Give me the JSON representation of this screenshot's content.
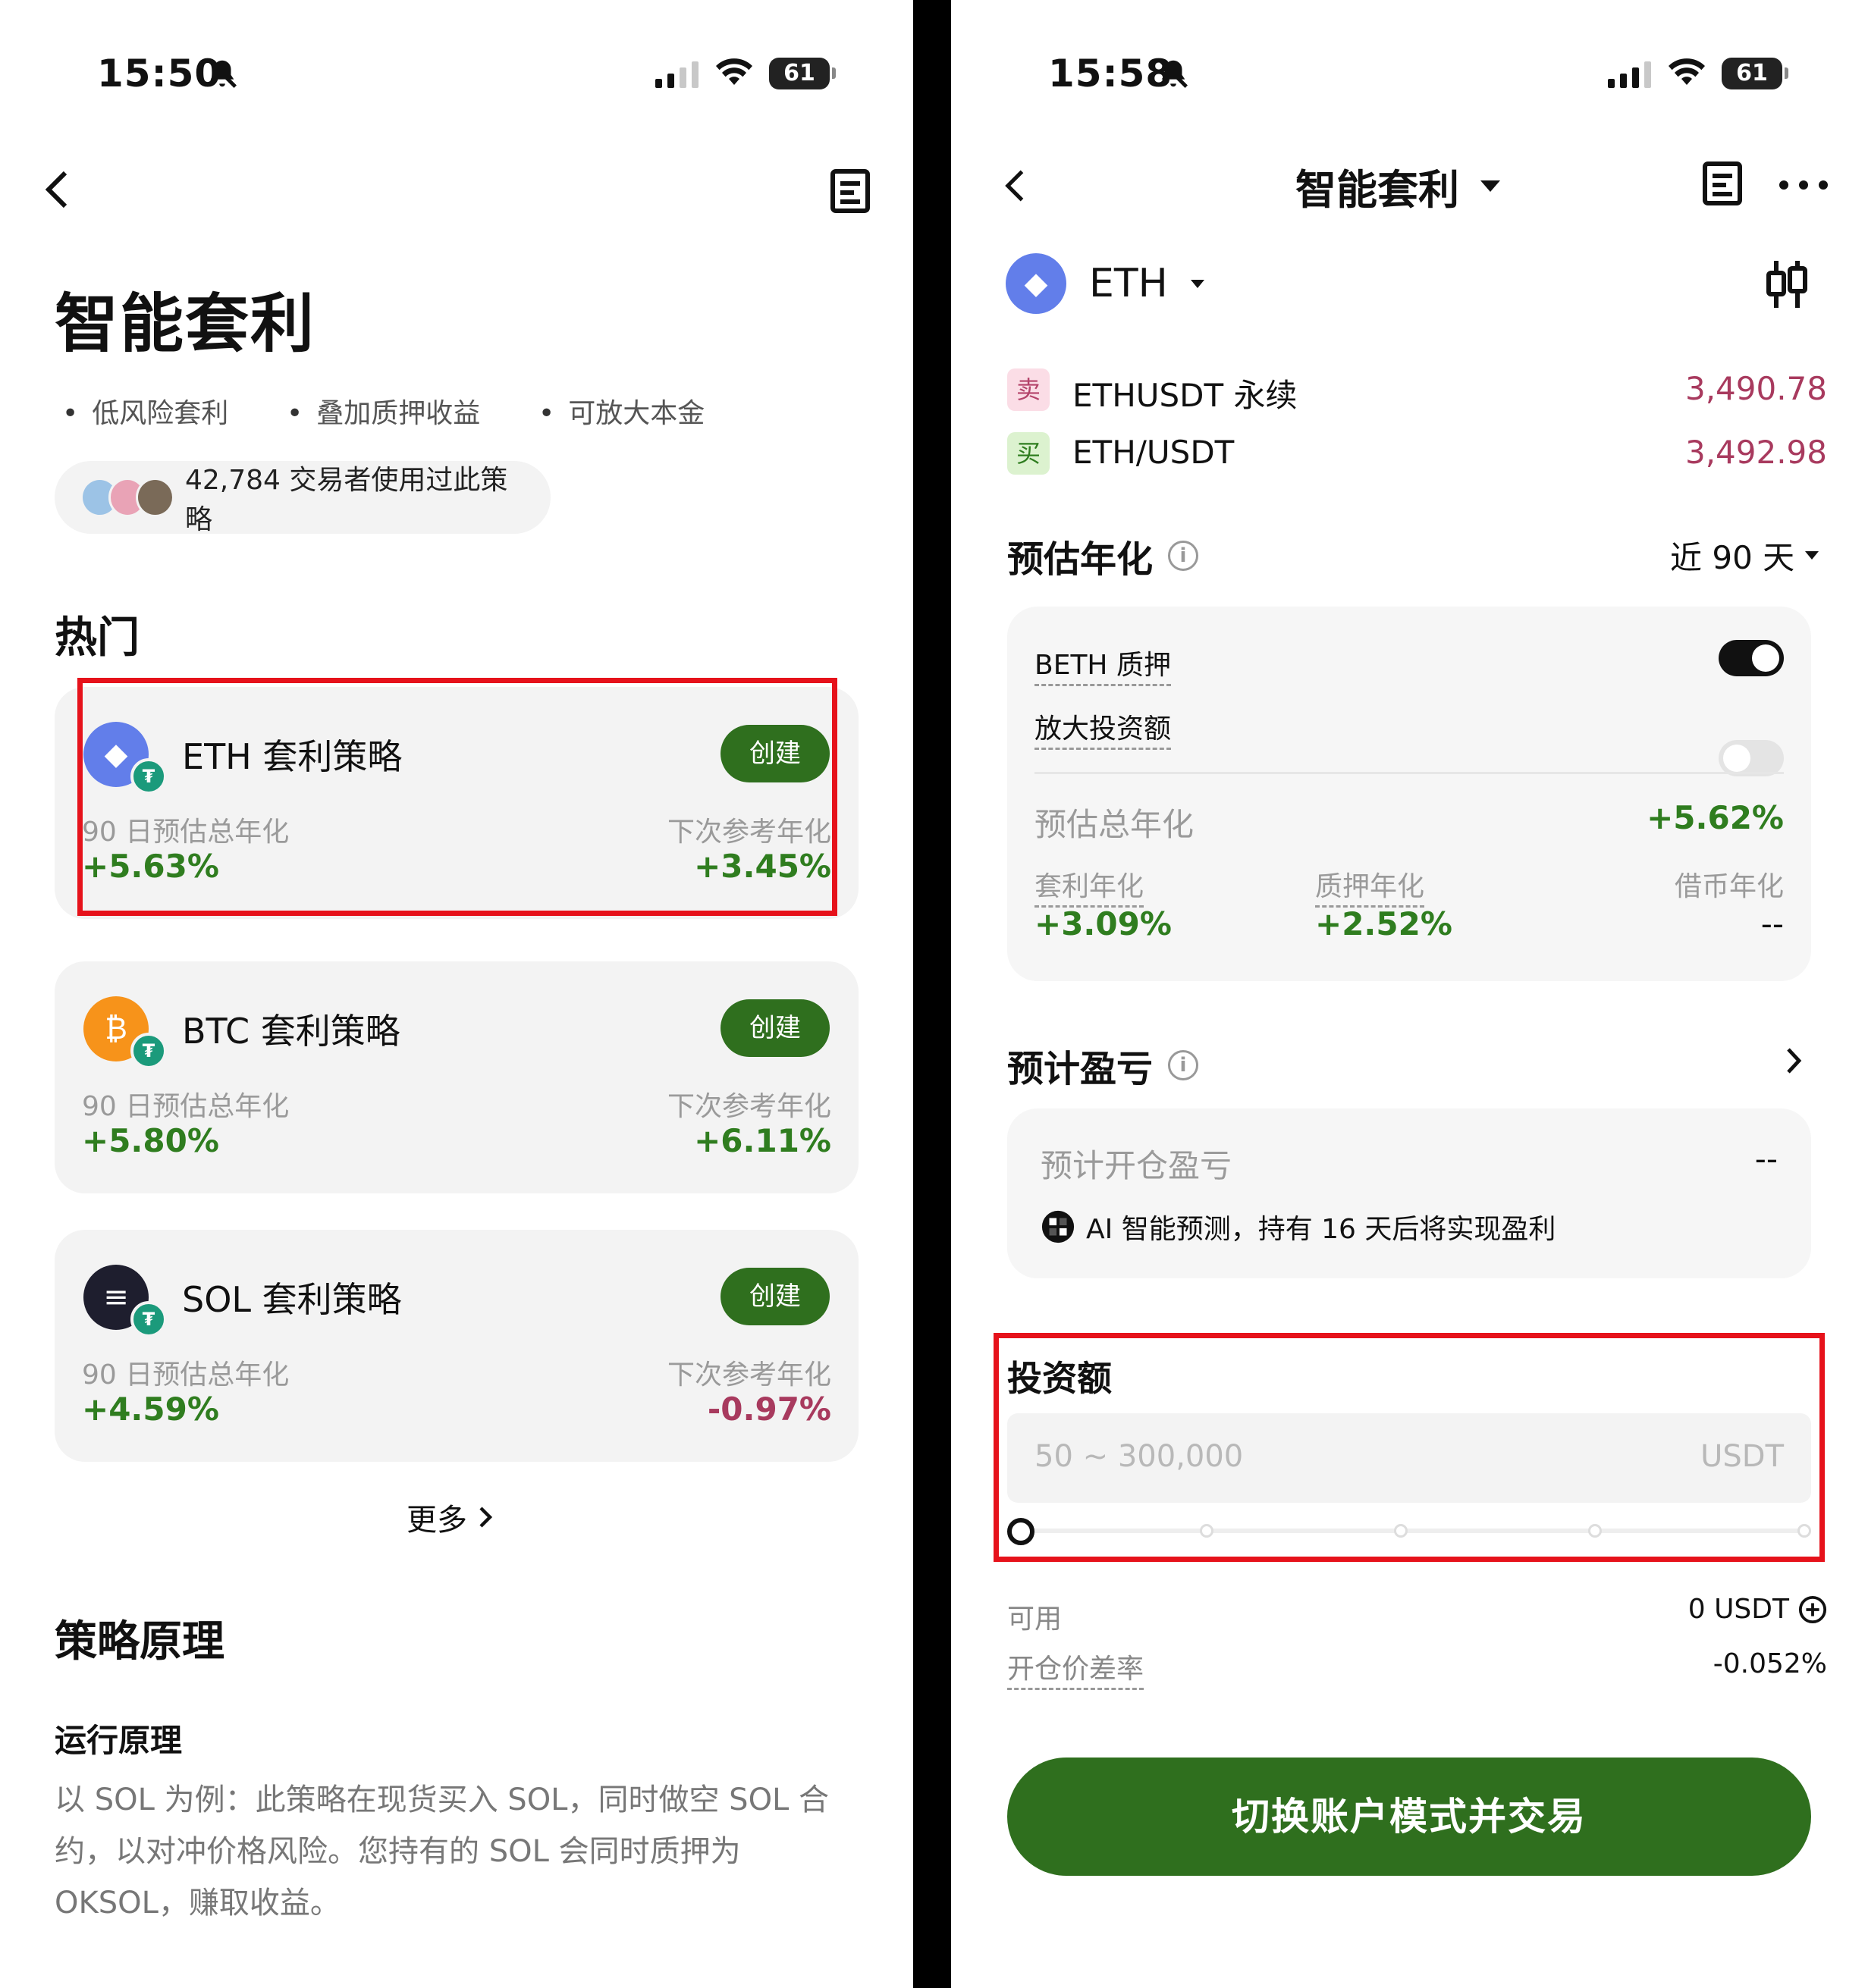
{
  "left": {
    "status": {
      "time": "15:50",
      "battery": "61"
    },
    "title": "智能套利",
    "features": [
      "低风险套利",
      "叠加质押收益",
      "可放大本金"
    ],
    "users_text": "42,784 交易者使用过此策略",
    "hot_heading": "热门",
    "cards": [
      {
        "name": "ETH 套利策略",
        "button": "创建",
        "left_label": "90 日预估总年化",
        "left_value": "+5.63%",
        "right_label": "下次参考年化",
        "right_value": "+3.45%",
        "coin_color": "#627eea",
        "coin_symbol": "◆"
      },
      {
        "name": "BTC 套利策略",
        "button": "创建",
        "left_label": "90 日预估总年化",
        "left_value": "+5.80%",
        "right_label": "下次参考年化",
        "right_value": "+6.11%",
        "coin_color": "#f7931a",
        "coin_symbol": "₿"
      },
      {
        "name": "SOL 套利策略",
        "button": "创建",
        "left_label": "90 日预估总年化",
        "left_value": "+4.59%",
        "right_label": "下次参考年化",
        "right_value": "-0.97%",
        "coin_color": "#1e1e2e",
        "coin_symbol": "≡"
      }
    ],
    "more": "更多",
    "principle_heading": "策略原理",
    "principle_sub": "运行原理",
    "principle_lines": [
      "以 SOL 为例：此策略在现货买入 SOL，同时做空 SOL 合",
      "约，以对冲价格风险。您持有的 SOL 会同时质押为",
      "OKSOL，赚取收益。"
    ]
  },
  "right": {
    "status": {
      "time": "15:58",
      "battery": "61"
    },
    "nav_title": "智能套利",
    "coin": "ETH",
    "pairs": [
      {
        "tag": "卖",
        "name": "ETHUSDT 永续",
        "price": "3,490.78",
        "tag_bg": "#fbdde6",
        "tag_color": "#b4436a"
      },
      {
        "tag": "买",
        "name": "ETH/USDT",
        "price": "3,492.98",
        "tag_bg": "#dcf2cf",
        "tag_color": "#2f7d1f"
      }
    ],
    "annual_heading": "预估年化",
    "period": "近 90 天",
    "beth_label": "BETH 质押",
    "beth_on": true,
    "amplify_label": "放大投资额",
    "amplify_on": false,
    "total_label": "预估总年化",
    "total_value": "+5.62%",
    "breakdown": [
      {
        "label": "套利年化",
        "value": "+3.09%"
      },
      {
        "label": "质押年化",
        "value": "+2.52%"
      },
      {
        "label": "借币年化",
        "value": "--"
      }
    ],
    "pnl_heading": "预计盈亏",
    "open_pnl_label": "预计开仓盈亏",
    "open_pnl_value": "--",
    "ai_text": "AI 智能预测，持有 16 天后将实现盈利",
    "invest_heading": "投资额",
    "invest_placeholder": "50 ~ 300,000",
    "invest_unit": "USDT",
    "slider_value": 0,
    "available_label": "可用",
    "available_value": "0 USDT",
    "spread_label": "开仓价差率",
    "spread_value": "-0.052%",
    "cta": "切换账户模式并交易"
  }
}
